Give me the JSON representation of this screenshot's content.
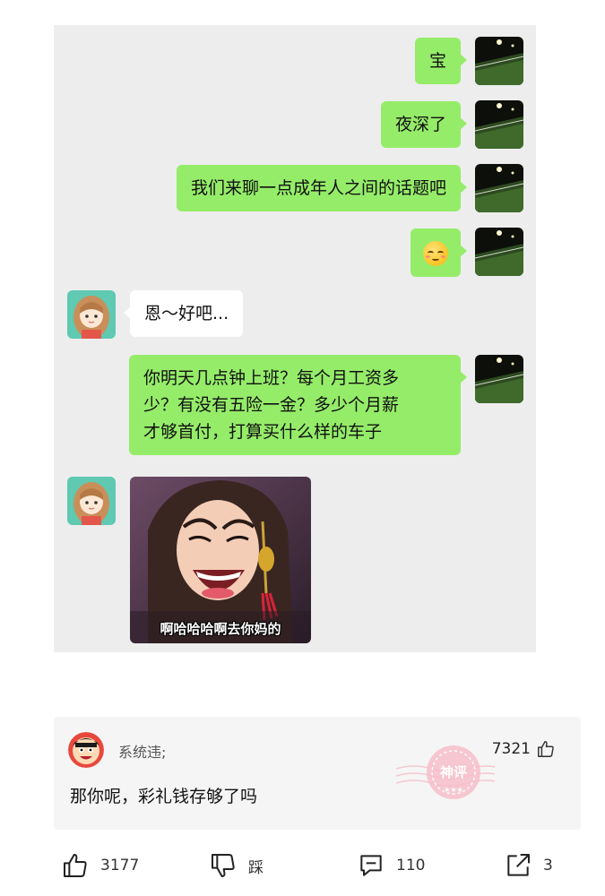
{
  "chat": {
    "messages": [
      {
        "from": "me",
        "text": "宝"
      },
      {
        "from": "me",
        "text": "夜深了"
      },
      {
        "from": "me",
        "text": "我们来聊一点成年人之间的话题吧"
      },
      {
        "from": "me",
        "emoji": "blushing-face"
      },
      {
        "from": "her",
        "text": "恩～好吧..."
      },
      {
        "from": "me",
        "lines": [
          "你明天几点钟上班？每个月工资多",
          "少？有没有五险一金？多少个月薪",
          "才够首付，打算买什么样的车子"
        ]
      },
      {
        "from": "her",
        "sticker_caption": "啊哈哈哈啊去你妈的"
      }
    ]
  },
  "comment": {
    "author": "系统违;",
    "likes": "7321",
    "text": "那你呢，彩礼钱存够了吗",
    "stamp_text": "神评",
    "stamp_color": "#f2a7b6"
  },
  "actions": {
    "like_count": "3177",
    "dislike_label": "踩",
    "comment_count": "110",
    "share_count": "3"
  },
  "colors": {
    "my_bubble": "#95ec69",
    "her_bubble": "#ffffff",
    "chat_background": "#ededed"
  }
}
